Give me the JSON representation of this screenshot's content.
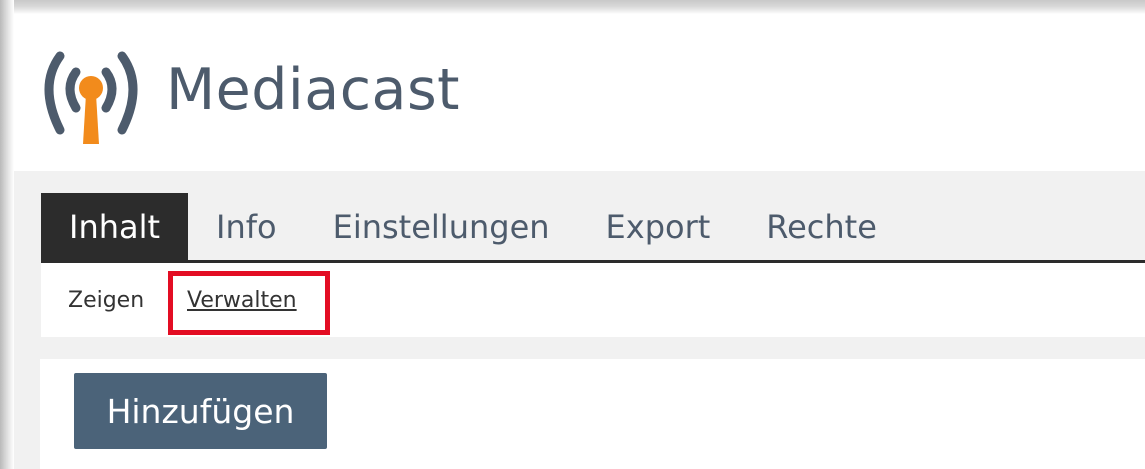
{
  "header": {
    "title": "Mediacast",
    "logo_icon": "mediacast-broadcast-icon",
    "colors": {
      "logo_primary": "#4d5b6c",
      "logo_accent": "#f28b1c"
    }
  },
  "tabs": [
    {
      "label": "Inhalt",
      "active": true
    },
    {
      "label": "Info",
      "active": false
    },
    {
      "label": "Einstellungen",
      "active": false
    },
    {
      "label": "Export",
      "active": false
    },
    {
      "label": "Rechte",
      "active": false
    }
  ],
  "subtabs": [
    {
      "label": "Zeigen"
    },
    {
      "label": "Verwalten",
      "highlighted": true
    }
  ],
  "actions": {
    "add_label": "Hinzufügen"
  },
  "colors": {
    "active_tab_bg": "#2c2c2c",
    "button_bg": "#4b6379",
    "highlight": "#e30d23"
  }
}
